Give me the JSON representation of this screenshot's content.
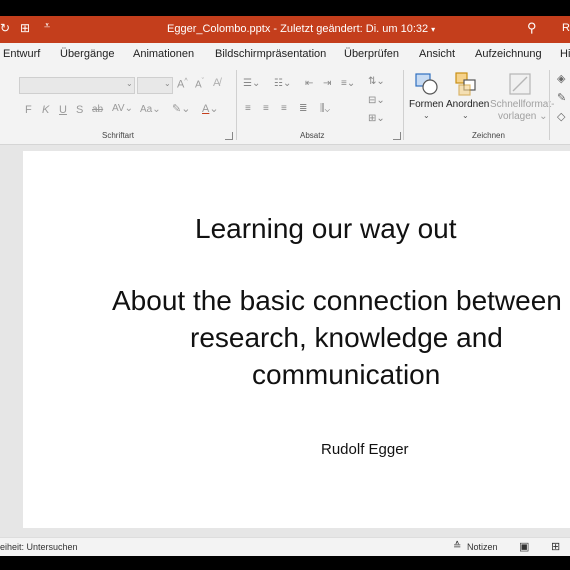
{
  "title_bar": {
    "file_name": "Egger_Colombo.pptx",
    "separator": "-",
    "saved_status": "Zuletzt geändert: Di. um 10:32",
    "right_initial": "R"
  },
  "ribbon_tabs": [
    "Entwurf",
    "Übergänge",
    "Animationen",
    "Bildschirmpräsentation",
    "Überprüfen",
    "Ansicht",
    "Aufzeichnung",
    "Hi"
  ],
  "ribbon": {
    "font_group_label": "Schriftart",
    "paragraph_group_label": "Absatz",
    "drawing_group_label": "Zeichnen",
    "font_buttons": {
      "bold": "F",
      "italic": "K",
      "underline": "U",
      "strike": "S",
      "shadow": "ab",
      "spacing": "AV",
      "case": "Aa",
      "grow": "A",
      "shrink": "A"
    },
    "shapes_label": "Formen",
    "arrange_label": "Anordnen",
    "quick_styles_label_1": "Schnellformat-",
    "quick_styles_label_2": "vorlagen"
  },
  "slide": {
    "title": "Learning our way out",
    "subtitle_line1": "About the basic connection between",
    "subtitle_line2": "research, knowledge and",
    "subtitle_line3": "communication",
    "author": "Rudolf Egger"
  },
  "status_bar": {
    "accessibility": "eiheit: Untersuchen",
    "notes_label": "Notizen"
  },
  "colors": {
    "accent": "#c43e1c",
    "ribbon_bg": "#f3f3f3",
    "workspace_bg": "#e6e6e6"
  }
}
